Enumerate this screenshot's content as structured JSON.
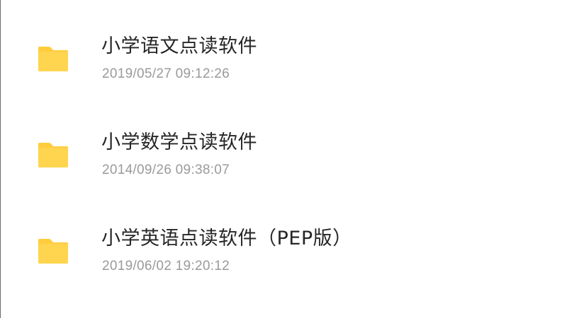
{
  "colors": {
    "folder": "#ffd54f",
    "folder_tab": "#ffcd3c",
    "title_text": "#262626",
    "date_text": "#9a9a9a"
  },
  "files": [
    {
      "icon": "folder-icon",
      "name": "小学语文点读软件",
      "date": "2019/05/27 09:12:26"
    },
    {
      "icon": "folder-icon",
      "name": "小学数学点读软件",
      "date": "2014/09/26 09:38:07"
    },
    {
      "icon": "folder-icon",
      "name": "小学英语点读软件（PEP版）",
      "date": "2019/06/02 19:20:12"
    }
  ]
}
